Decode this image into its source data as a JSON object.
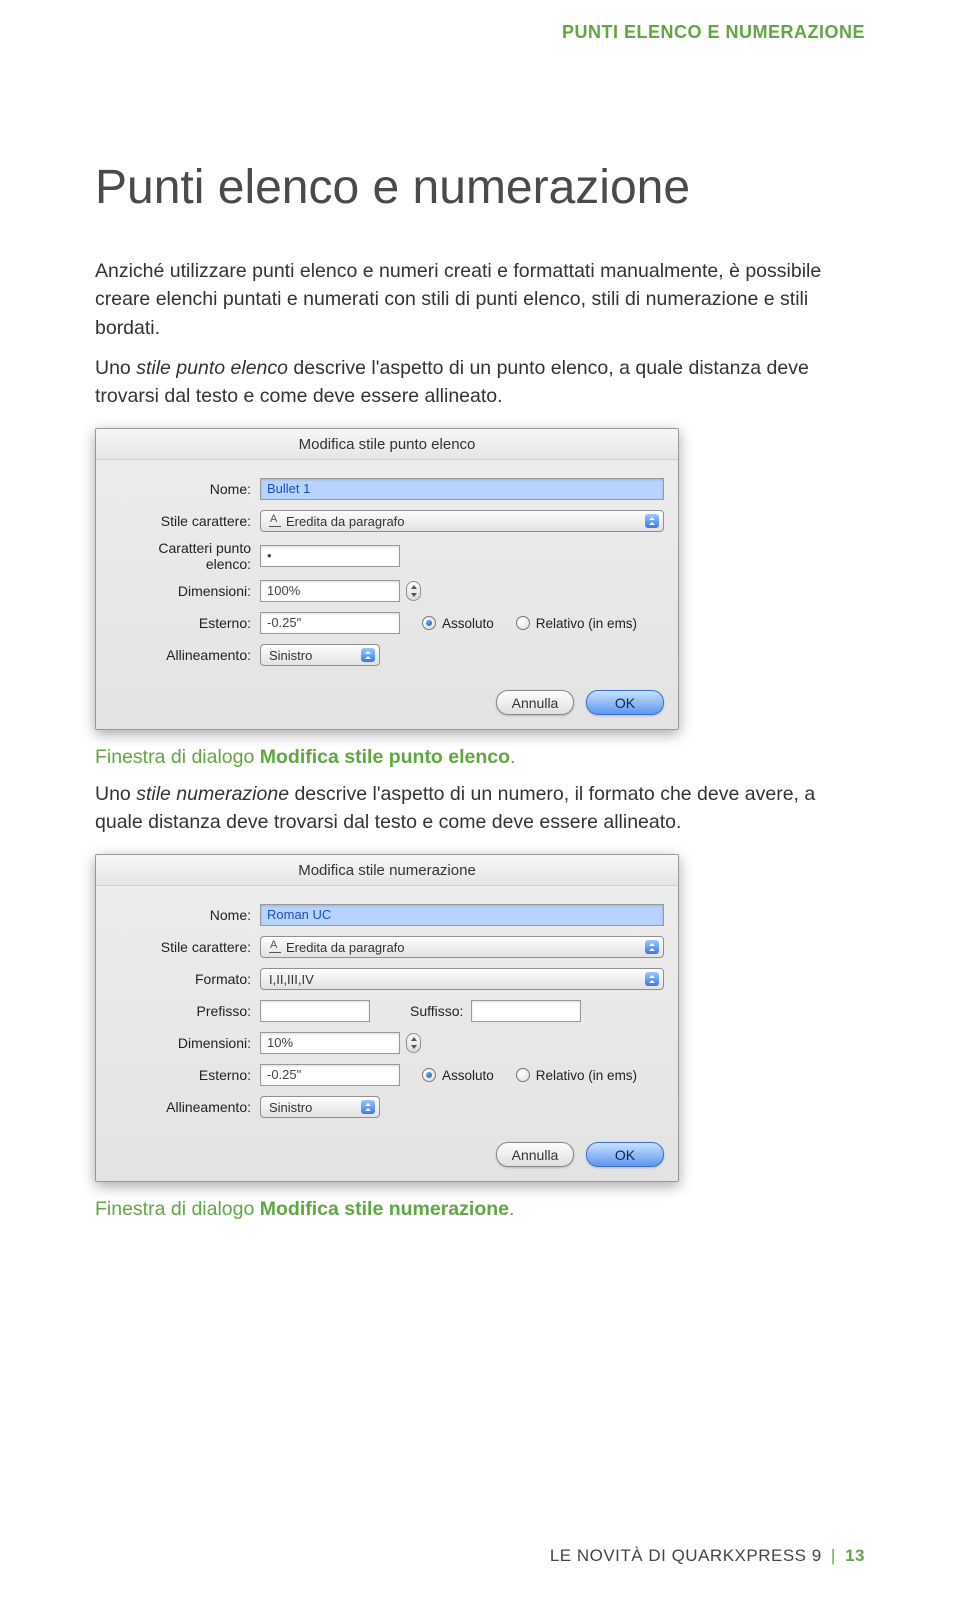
{
  "header": {
    "section_label": "PUNTI ELENCO E NUMERAZIONE"
  },
  "title": "Punti elenco e numerazione",
  "para1": "Anziché utilizzare punti elenco e numeri creati e formattati manualmente, è possibile creare elenchi puntati e numerati con stili di punti elenco, stili di numerazione e stili bordati.",
  "para2_pre": "Uno ",
  "para2_em": "stile punto elenco",
  "para2_post": " descrive l'aspetto di un punto elenco, a quale distanza deve trovarsi dal testo e come deve essere allineato.",
  "caption1_pre": "Finestra di dialogo ",
  "caption1_bold": "Modifica stile punto elenco",
  "caption1_post": ".",
  "para3_pre": "Uno ",
  "para3_em": "stile numerazione",
  "para3_post": " descrive l'aspetto di un numero, il formato che deve avere, a quale distanza deve trovarsi dal testo e come deve essere allineato.",
  "caption2_pre": "Finestra di dialogo ",
  "caption2_bold": "Modifica stile numerazione",
  "caption2_post": ".",
  "dialog1": {
    "title": "Modifica stile punto elenco",
    "labels": {
      "nome": "Nome:",
      "stile_carattere": "Stile carattere:",
      "caratteri": "Caratteri punto elenco:",
      "dimensioni": "Dimensioni:",
      "esterno": "Esterno:",
      "allineamento": "Allineamento:"
    },
    "values": {
      "nome": "Bullet 1",
      "stile_carattere": "Eredita da paragrafo",
      "caratteri": "•",
      "dimensioni": "100%",
      "esterno": "-0.25\"",
      "allineamento": "Sinistro"
    },
    "radios": {
      "assoluto": "Assoluto",
      "relativo": "Relativo (in ems)"
    },
    "buttons": {
      "cancel": "Annulla",
      "ok": "OK"
    }
  },
  "dialog2": {
    "title": "Modifica stile numerazione",
    "labels": {
      "nome": "Nome:",
      "stile_carattere": "Stile carattere:",
      "formato": "Formato:",
      "prefisso": "Prefisso:",
      "suffisso": "Suffisso:",
      "dimensioni": "Dimensioni:",
      "esterno": "Esterno:",
      "allineamento": "Allineamento:"
    },
    "values": {
      "nome": "Roman UC",
      "stile_carattere": "Eredita da paragrafo",
      "formato": "I,II,III,IV",
      "prefisso": "",
      "suffisso": "",
      "dimensioni": "10%",
      "esterno": "-0.25\"",
      "allineamento": "Sinistro"
    },
    "radios": {
      "assoluto": "Assoluto",
      "relativo": "Relativo (in ems)"
    },
    "buttons": {
      "cancel": "Annulla",
      "ok": "OK"
    }
  },
  "footer": {
    "text": "LE NOVITÀ DI QUARKXPRESS 9",
    "sep": "|",
    "page": "13"
  }
}
